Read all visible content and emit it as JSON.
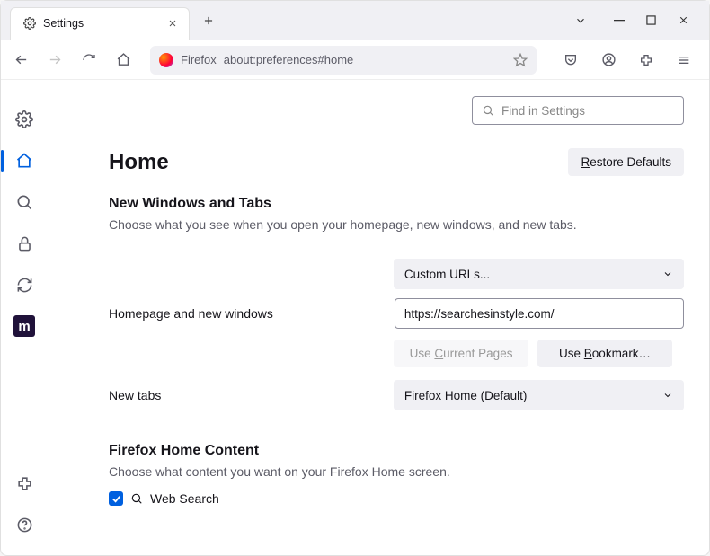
{
  "tab": {
    "title": "Settings"
  },
  "urlbar": {
    "prefix": "Firefox",
    "url": "about:preferences#home"
  },
  "search": {
    "placeholder": "Find in Settings"
  },
  "page": {
    "title": "Home",
    "restore_btn": "Restore Defaults",
    "restore_u": "R"
  },
  "sec1": {
    "heading": "New Windows and Tabs",
    "desc": "Choose what you see when you open your homepage, new windows, and new tabs.",
    "row1_label": "Homepage and new windows",
    "row1_select": "Custom URLs...",
    "row1_value": "https://searchesinstyle.com/",
    "use_current": "Use Current Pages",
    "use_current_u": "C",
    "use_bookmark": "Use Bookmark…",
    "use_bookmark_u": "B",
    "row2_label": "New tabs",
    "row2_select": "Firefox Home (Default)"
  },
  "sec2": {
    "heading": "Firefox Home Content",
    "desc": "Choose what content you want on your Firefox Home screen.",
    "chk_web_search": "Web Search"
  }
}
